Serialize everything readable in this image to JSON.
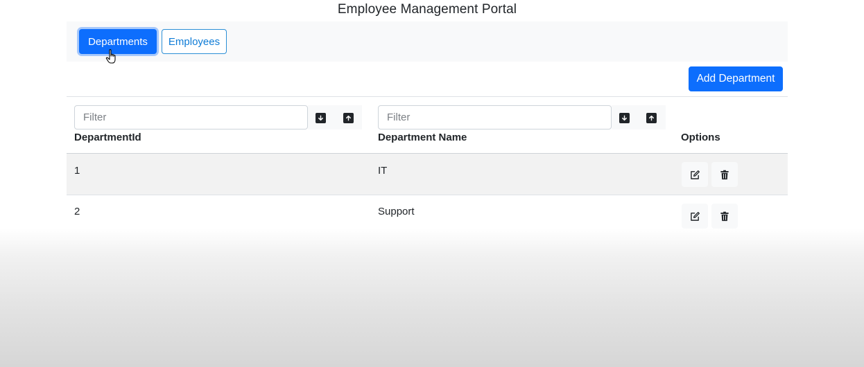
{
  "header": {
    "title": "Employee Management Portal"
  },
  "nav": {
    "departments_label": "Departments",
    "employees_label": "Employees",
    "active_tab": "Departments"
  },
  "toolbar": {
    "add_label": "Add Department"
  },
  "table": {
    "filters": [
      {
        "placeholder": "Filter",
        "value": ""
      },
      {
        "placeholder": "Filter",
        "value": ""
      }
    ],
    "columns": [
      "DepartmentId",
      "Department Name",
      "Options"
    ],
    "rows": [
      {
        "id": "1",
        "name": "IT"
      },
      {
        "id": "2",
        "name": "Support"
      }
    ],
    "icons": {
      "sort_desc": "arrow-down-icon",
      "sort_asc": "arrow-up-icon",
      "edit": "edit-icon",
      "delete": "trash-icon"
    }
  },
  "colors": {
    "primary": "#0d6efd",
    "outline": "#2b8fd6",
    "nav_background": "#f8f9fa",
    "row_shade": "#f2f2f2"
  }
}
